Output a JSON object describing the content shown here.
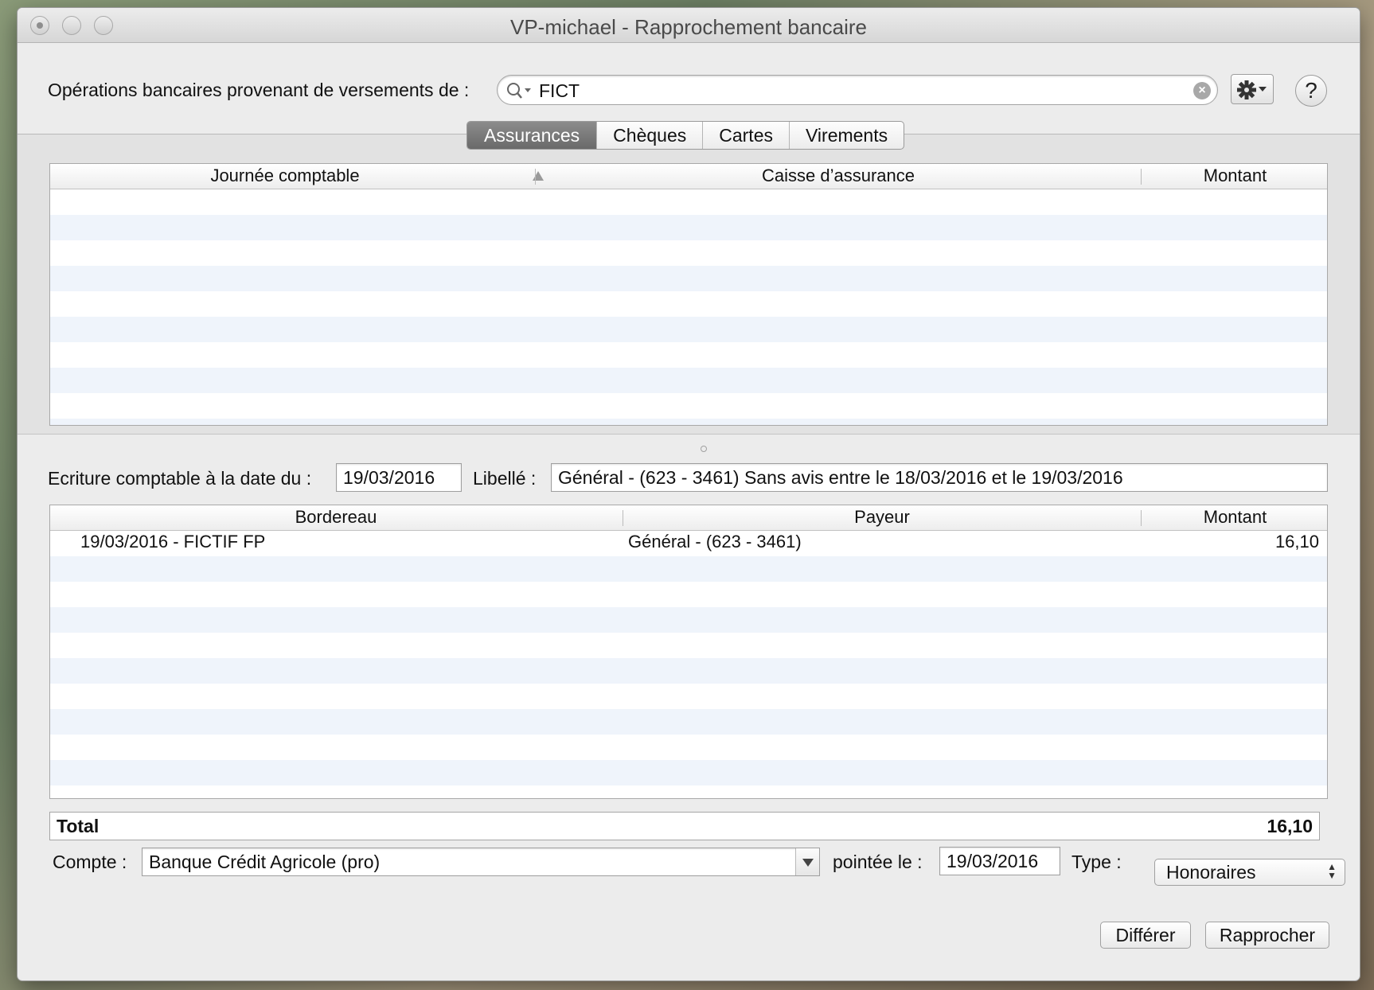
{
  "window": {
    "title": "VP-michael - Rapprochement bancaire"
  },
  "header": {
    "label": "Opérations bancaires provenant de versements de :",
    "search_value": "FICT",
    "gear_icon": "gear-icon",
    "help_label": "?"
  },
  "tabs": [
    {
      "label": "Assurances",
      "active": true
    },
    {
      "label": "Chèques",
      "active": false
    },
    {
      "label": "Cartes",
      "active": false
    },
    {
      "label": "Virements",
      "active": false
    }
  ],
  "top_table": {
    "columns": [
      "Journée comptable",
      "Caisse d’assurance",
      "Montant"
    ],
    "rows": []
  },
  "entry": {
    "date_label": "Ecriture comptable à la date du :",
    "date_value": "19/03/2016",
    "libelle_label": "Libellé :",
    "libelle_value": "Général - (623 - 3461)  Sans avis entre le 18/03/2016 et le 19/03/2016"
  },
  "bottom_table": {
    "columns": [
      "Bordereau",
      "Payeur",
      "Montant"
    ],
    "rows": [
      {
        "bordereau": "19/03/2016 - FICTIF  FP",
        "payeur": "Général - (623 - 3461)",
        "montant": "16,10"
      }
    ]
  },
  "total": {
    "label": "Total",
    "value": "16,10"
  },
  "footer": {
    "compte_label": "Compte :",
    "compte_value": "Banque Crédit Agricole (pro)",
    "pointee_label": "pointée le :",
    "pointee_value": "19/03/2016",
    "type_label": "Type :",
    "type_value": "Honoraires",
    "differer_label": "Différer",
    "rapprocher_label": "Rapprocher"
  }
}
